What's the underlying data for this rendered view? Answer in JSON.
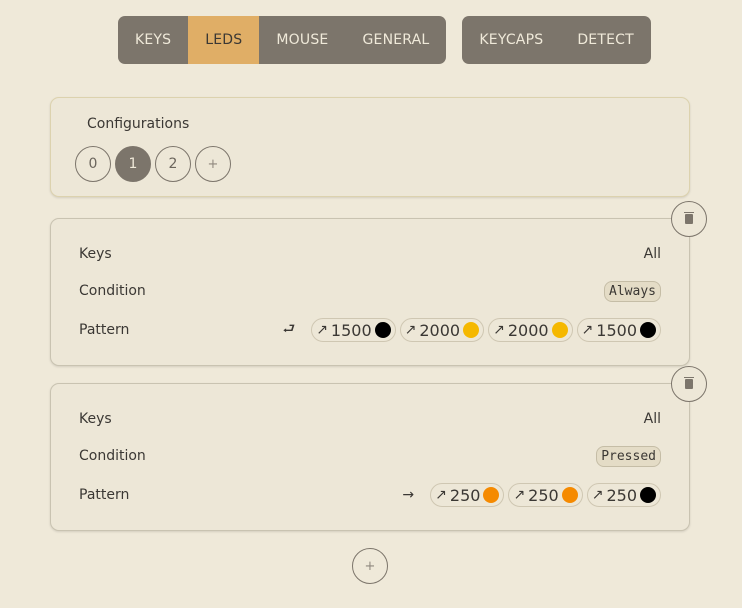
{
  "nav": {
    "group1": [
      {
        "label": "KEYS",
        "active": false
      },
      {
        "label": "LEDS",
        "active": true
      },
      {
        "label": "MOUSE",
        "active": false
      },
      {
        "label": "GENERAL",
        "active": false
      }
    ],
    "group2": [
      {
        "label": "KEYCAPS",
        "active": false
      },
      {
        "label": "DETECT",
        "active": false
      }
    ]
  },
  "configurations": {
    "title": "Configurations",
    "items": [
      "0",
      "1",
      "2"
    ],
    "active_index": 1,
    "add_label": "+"
  },
  "rules": [
    {
      "keys_label": "Keys",
      "keys_value": "All",
      "condition_label": "Condition",
      "condition_value": "Always",
      "pattern_label": "Pattern",
      "pattern_mode_icon": "loop-icon",
      "pattern_mode_glyph": "⮐",
      "steps": [
        {
          "arrow": "↗",
          "duration": "1500",
          "color": "#000000"
        },
        {
          "arrow": "↗",
          "duration": "2000",
          "color": "#f5b800"
        },
        {
          "arrow": "↗",
          "duration": "2000",
          "color": "#f5b800"
        },
        {
          "arrow": "↗",
          "duration": "1500",
          "color": "#000000"
        }
      ]
    },
    {
      "keys_label": "Keys",
      "keys_value": "All",
      "condition_label": "Condition",
      "condition_value": "Pressed",
      "pattern_label": "Pattern",
      "pattern_mode_icon": "once-arrow-icon",
      "pattern_mode_glyph": "→",
      "steps": [
        {
          "arrow": "↗",
          "duration": "250",
          "color": "#f58a00"
        },
        {
          "arrow": "↗",
          "duration": "250",
          "color": "#f58a00"
        },
        {
          "arrow": "↗",
          "duration": "250",
          "color": "#000000"
        }
      ]
    }
  ],
  "add_rule_label": "+"
}
